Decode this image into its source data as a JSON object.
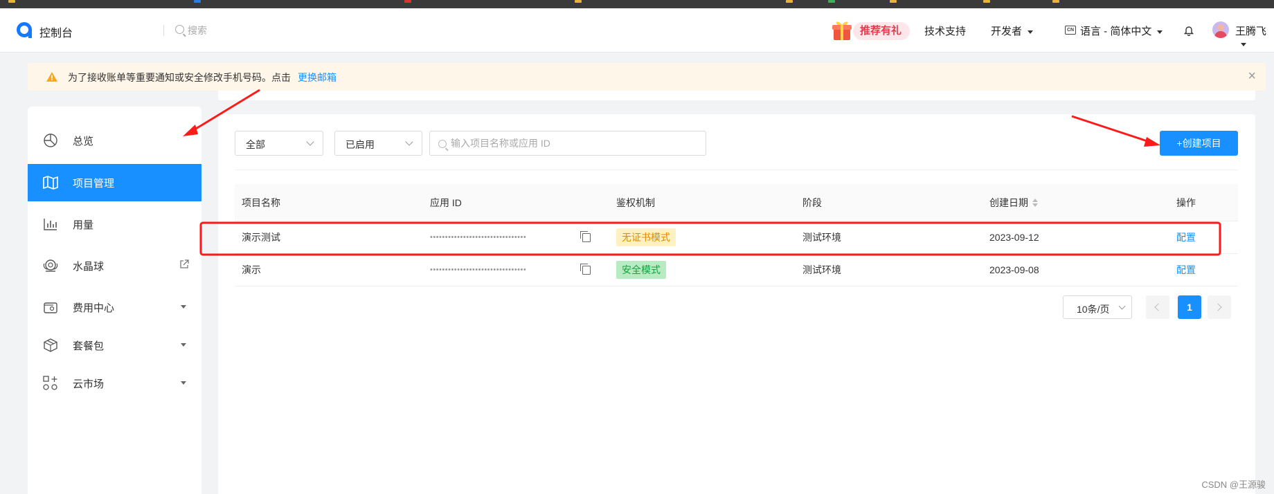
{
  "colors": {
    "accent": "#1890ff",
    "annotation": "#ff1a1a",
    "warn": "#f5a623",
    "gift": "#e83a4a"
  },
  "topbar": {
    "brand": "控制台",
    "search_placeholder": "搜索",
    "gift_label": "推荐有礼",
    "support": "技术支持",
    "developer": "开发者",
    "lang_icon_text": "CN",
    "language": "语言 - 简体中文",
    "user_name": "王腾飞"
  },
  "notice": {
    "text": "为了接收账单等重要通知或安全修改手机号码。点击",
    "link": "更换邮箱",
    "close": "×"
  },
  "sidebar": {
    "items": [
      {
        "label": "总览",
        "icon": "pie-chart-icon"
      },
      {
        "label": "项目管理",
        "icon": "map-icon"
      },
      {
        "label": "用量",
        "icon": "bar-chart-icon"
      },
      {
        "label": "水晶球",
        "icon": "crystal-ball-icon"
      },
      {
        "label": "费用中心",
        "icon": "wallet-icon"
      },
      {
        "label": "套餐包",
        "icon": "package-icon"
      },
      {
        "label": "云市场",
        "icon": "apps-icon"
      }
    ]
  },
  "filters": {
    "scope": "全部",
    "status": "已启用",
    "search_placeholder": "输入项目名称或应用 ID",
    "create_button": "+创建项目"
  },
  "table": {
    "headers": [
      "项目名称",
      "应用 ID",
      "鉴权机制",
      "阶段",
      "创建日期",
      "操作"
    ],
    "rows": [
      {
        "name": "演示测试",
        "app_id": "••••••••••••••••••••••••••••••••",
        "auth": "无证书模式",
        "stage": "测试环境",
        "date": "2023-09-12",
        "action": "配置"
      },
      {
        "name": "演示",
        "app_id": "••••••••••••••••••••••••••••••••",
        "auth": "安全模式",
        "stage": "测试环境",
        "date": "2023-09-08",
        "action": "配置"
      }
    ]
  },
  "pagination": {
    "page_size": "10条/页",
    "current_page": "1"
  },
  "watermark": "CSDN @王源骏"
}
